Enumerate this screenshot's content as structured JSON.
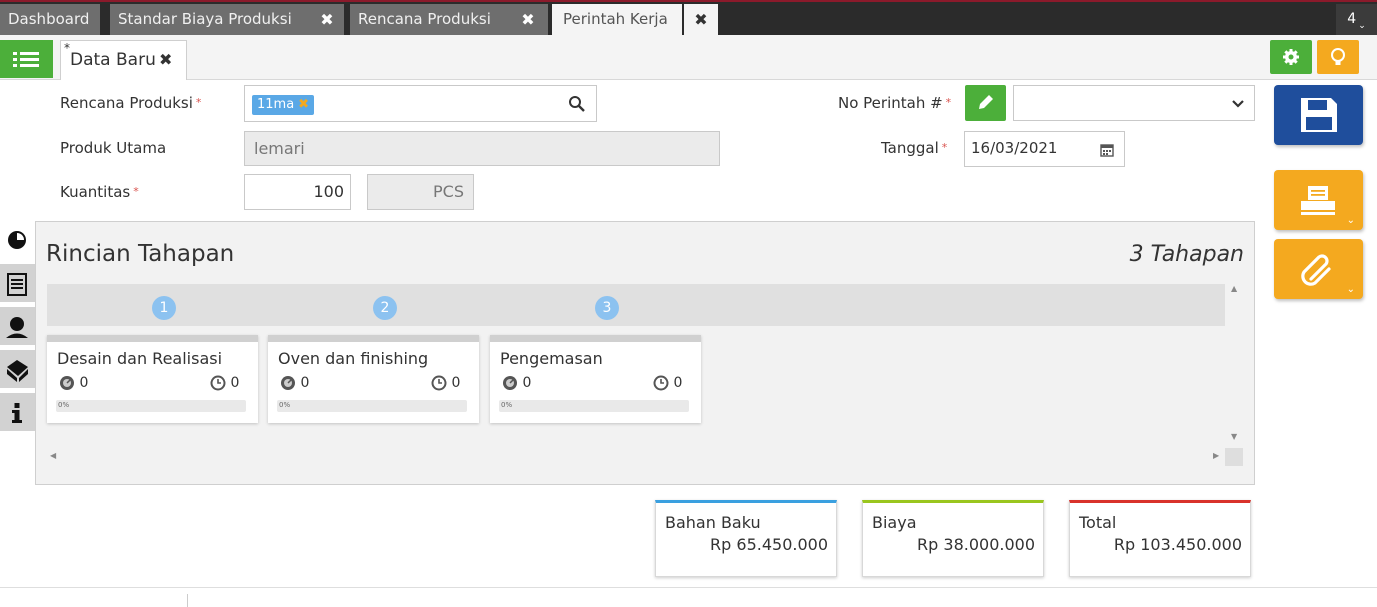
{
  "tabs": [
    {
      "label": "Dashboard"
    },
    {
      "label": "Standar Biaya Produksi"
    },
    {
      "label": "Rencana Produksi"
    },
    {
      "label": "Perintah Kerja"
    }
  ],
  "tab_count": "4",
  "subtab": {
    "label": "Data Baru",
    "marker": "*"
  },
  "form": {
    "rencana_produksi": {
      "label": "Rencana Produksi",
      "tag": "11ma"
    },
    "produk_utama": {
      "label": "Produk Utama",
      "value": "lemari"
    },
    "kuantitas": {
      "label": "Kuantitas",
      "value": "100",
      "unit": "PCS"
    },
    "no_perintah": {
      "label": "No Perintah #",
      "value": ""
    },
    "tanggal": {
      "label": "Tanggal",
      "value": "16/03/2021"
    },
    "required_mark": "*"
  },
  "panel": {
    "title": "Rincian Tahapan",
    "count": "3 Tahapan",
    "steps": [
      {
        "num": "1",
        "name": "Desain dan Realisasi",
        "left_val": "0",
        "right_val": "0",
        "progress": "0%"
      },
      {
        "num": "2",
        "name": "Oven dan finishing",
        "left_val": "0",
        "right_val": "0",
        "progress": "0%"
      },
      {
        "num": "3",
        "name": "Pengemasan",
        "left_val": "0",
        "right_val": "0",
        "progress": "0%"
      }
    ]
  },
  "totals": [
    {
      "label": "Bahan Baku",
      "value": "Rp 65.450.000",
      "color": "#3aa0e0"
    },
    {
      "label": "Biaya",
      "value": "Rp 38.000.000",
      "color": "#9ac61e"
    },
    {
      "label": "Total",
      "value": "Rp 103.450.000",
      "color": "#d9322b"
    }
  ],
  "colors": {
    "green": "#4caf3a",
    "orange": "#f4a91f",
    "blue": "#1f4e9c",
    "tab_bg": "#6e6e6e"
  },
  "icons": [
    "list-icon",
    "gear-icon",
    "bulb-icon",
    "search-icon",
    "pencil-icon",
    "chevron-down-icon",
    "calendar-icon",
    "save-icon",
    "print-icon",
    "attach-icon",
    "pie-icon",
    "document-icon",
    "person-icon",
    "box-icon",
    "info-icon",
    "close-icon"
  ]
}
